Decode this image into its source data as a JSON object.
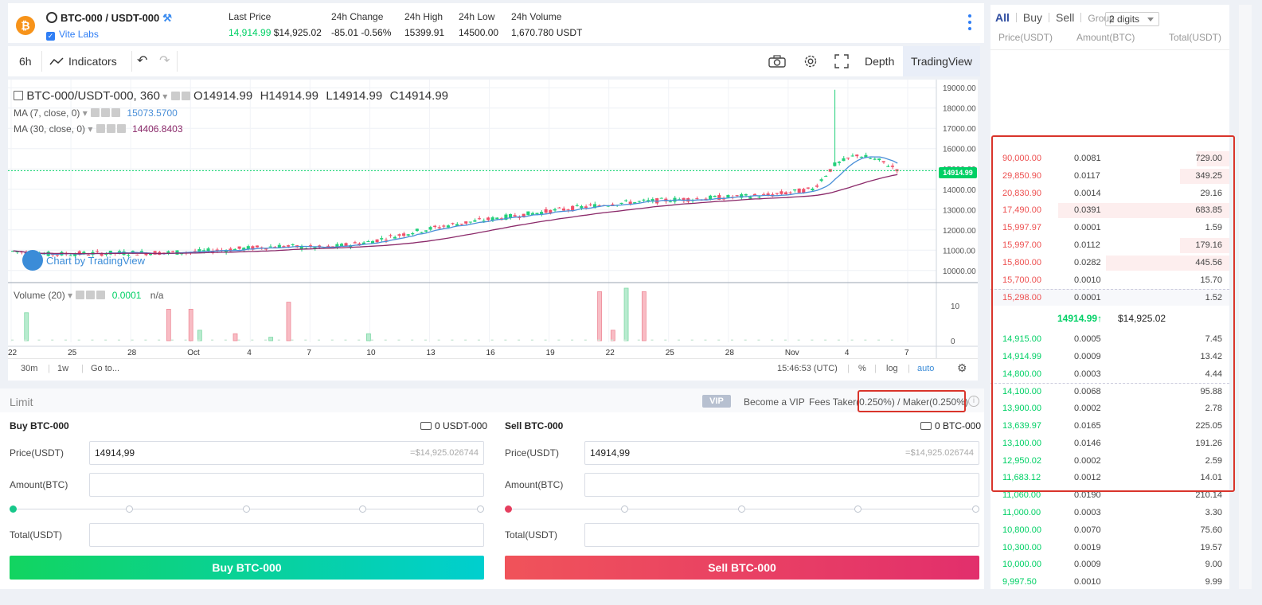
{
  "header": {
    "pair": "BTC-000 / USDT-000",
    "issuer": "Vite Labs",
    "last_price_label": "Last Price",
    "last_price": "14,914.99",
    "last_price_usd": "$14,925.02",
    "change_label": "24h Change",
    "change_value": "-85.01",
    "change_pct": "-0.56%",
    "high_label": "24h High",
    "high_value": "15399.91",
    "low_label": "24h Low",
    "low_value": "14500.00",
    "volume_label": "24h Volume",
    "volume_value": "1,670.780 USDT",
    "coin_letter": "₿"
  },
  "toolbar": {
    "interval": "6h",
    "indicators": "Indicators",
    "depth": "Depth",
    "tradingview": "TradingView"
  },
  "chart": {
    "symbol": "BTC-000/USDT-000, 360",
    "o_label": "O",
    "o": "14914.99",
    "h_label": "H",
    "h": "14914.99",
    "l_label": "L",
    "l": "14914.99",
    "c_label": "C",
    "c": "14914.99",
    "ma7_label": "MA (7, close, 0)",
    "ma7_value": "15073.5700",
    "ma30_label": "MA (30, close, 0)",
    "ma30_value": "14406.8403",
    "volume_label": "Volume (20)",
    "volume_value": "0.0001",
    "volume_na": "n/a",
    "watermark": "Chart by TradingView",
    "current_price_tag": "14914.99",
    "time": "15:46:53 (UTC)",
    "btn_30m": "30m",
    "btn_1w": "1w",
    "goto": "Go to...",
    "pct": "%",
    "log": "log",
    "auto": "auto"
  },
  "chart_data": {
    "type": "candlestick",
    "price_ticks": [
      "19000.00",
      "18000.00",
      "17000.00",
      "16000.00",
      "15000.00",
      "14000.00",
      "13000.00",
      "12000.00",
      "11000.00",
      "10000.00"
    ],
    "volume_ticks": [
      "10",
      "0"
    ],
    "x_ticks": [
      "22",
      "25",
      "28",
      "Oct",
      "4",
      "7",
      "10",
      "13",
      "16",
      "19",
      "22",
      "25",
      "28",
      "Nov",
      "4",
      "7"
    ],
    "ylim": [
      9600,
      19400
    ],
    "current_price": 14914.99,
    "ma7_last": 15073.57,
    "ma30_last": 14406.8403,
    "series_trend": [
      [
        0,
        10950
      ],
      [
        8,
        10800
      ],
      [
        20,
        10850
      ],
      [
        40,
        10900
      ],
      [
        60,
        11200
      ],
      [
        70,
        11100
      ],
      [
        80,
        11400
      ],
      [
        90,
        11900
      ],
      [
        100,
        12300
      ],
      [
        110,
        12600
      ],
      [
        120,
        12900
      ],
      [
        135,
        13300
      ],
      [
        150,
        13500
      ],
      [
        160,
        13600
      ],
      [
        170,
        13700
      ],
      [
        180,
        14000
      ],
      [
        185,
        15200
      ],
      [
        190,
        15700
      ],
      [
        195,
        15400
      ],
      [
        200,
        14900
      ]
    ],
    "volume_spikes": [
      {
        "i": 3,
        "v": 8,
        "up": true
      },
      {
        "i": 35,
        "v": 9,
        "up": false
      },
      {
        "i": 40,
        "v": 9,
        "up": false
      },
      {
        "i": 42,
        "v": 3,
        "up": true
      },
      {
        "i": 50,
        "v": 2,
        "up": false
      },
      {
        "i": 58,
        "v": 1,
        "up": true
      },
      {
        "i": 62,
        "v": 11,
        "up": false
      },
      {
        "i": 80,
        "v": 2,
        "up": true
      },
      {
        "i": 132,
        "v": 14,
        "up": false
      },
      {
        "i": 135,
        "v": 3,
        "up": false
      },
      {
        "i": 138,
        "v": 15,
        "up": true
      },
      {
        "i": 142,
        "v": 14,
        "up": false
      }
    ]
  },
  "form": {
    "mode": "Limit",
    "vip": "VIP",
    "become_vip": "Become a VIP",
    "fees_prefix": "Fees Taker",
    "fees_value": "0.250%) / Maker(0.250%)",
    "buy": {
      "title": "Buy BTC-000",
      "balance": "0 USDT-000",
      "price_label": "Price(USDT)",
      "price": "14914,99",
      "price_hint": "=$14,925.026744",
      "amount_label": "Amount(BTC)",
      "total_label": "Total(USDT)",
      "button": "Buy BTC-000",
      "color": "#17d36f"
    },
    "sell": {
      "title": "Sell BTC-000",
      "balance": "0 BTC-000",
      "price_label": "Price(USDT)",
      "price": "14914,99",
      "price_hint": "=$14,925.026744",
      "amount_label": "Amount(BTC)",
      "total_label": "Total(USDT)",
      "button": "Sell BTC-000",
      "color": "#ee4d5a"
    }
  },
  "book": {
    "tabs": [
      "All",
      "Buy",
      "Sell"
    ],
    "group_label": "Group",
    "group_value": "2 digits",
    "head_price": "Price(USDT)",
    "head_amount": "Amount(BTC)",
    "head_total": "Total(USDT)",
    "asks": [
      {
        "price": "90,000.00",
        "amount": "0.0081",
        "total": "729.00",
        "depth": 0.19
      },
      {
        "price": "29,850.90",
        "amount": "0.0117",
        "total": "349.25",
        "depth": 0.29
      },
      {
        "price": "20,830.90",
        "amount": "0.0014",
        "total": "29.16",
        "depth": 0.0
      },
      {
        "price": "17,490.00",
        "amount": "0.0391",
        "total": "683.85",
        "depth": 1.0
      },
      {
        "price": "15,997.97",
        "amount": "0.0001",
        "total": "1.59",
        "depth": 0.0
      },
      {
        "price": "15,997.00",
        "amount": "0.0112",
        "total": "179.16",
        "depth": 0.29
      },
      {
        "price": "15,800.00",
        "amount": "0.0282",
        "total": "445.56",
        "depth": 0.72
      },
      {
        "price": "15,700.00",
        "amount": "0.0010",
        "total": "15.70",
        "depth": 0.0
      },
      {
        "price": "15,298.00",
        "amount": "0.0001",
        "total": "1.52",
        "depth": 0.0
      }
    ],
    "last_price": "14914.99",
    "last_arrow": "↑",
    "last_usd": "$14,925.02",
    "bids": [
      {
        "price": "14,915.00",
        "amount": "0.0005",
        "total": "7.45",
        "depth": 0.0
      },
      {
        "price": "14,914.99",
        "amount": "0.0009",
        "total": "13.42",
        "depth": 0.0
      },
      {
        "price": "14,800.00",
        "amount": "0.0003",
        "total": "4.44",
        "depth": 0.0
      },
      {
        "price": "14,100.00",
        "amount": "0.0068",
        "total": "95.88",
        "depth": 0.0
      },
      {
        "price": "13,900.00",
        "amount": "0.0002",
        "total": "2.78",
        "depth": 0.0
      },
      {
        "price": "13,639.97",
        "amount": "0.0165",
        "total": "225.05",
        "depth": 0.0
      },
      {
        "price": "13,100.00",
        "amount": "0.0146",
        "total": "191.26",
        "depth": 0.0
      },
      {
        "price": "12,950.02",
        "amount": "0.0002",
        "total": "2.59",
        "depth": 0.0
      },
      {
        "price": "11,683.12",
        "amount": "0.0012",
        "total": "14.01",
        "depth": 0.0
      },
      {
        "price": "11,060.00",
        "amount": "0.0190",
        "total": "210.14",
        "depth": 0.0
      },
      {
        "price": "11,000.00",
        "amount": "0.0003",
        "total": "3.30",
        "depth": 0.0
      },
      {
        "price": "10,800.00",
        "amount": "0.0070",
        "total": "75.60",
        "depth": 0.0
      },
      {
        "price": "10,300.00",
        "amount": "0.0019",
        "total": "19.57",
        "depth": 0.0
      },
      {
        "price": "10,000.00",
        "amount": "0.0009",
        "total": "9.00",
        "depth": 0.0
      },
      {
        "price": "9,997.50",
        "amount": "0.0010",
        "total": "9.99",
        "depth": 0.0
      }
    ]
  }
}
